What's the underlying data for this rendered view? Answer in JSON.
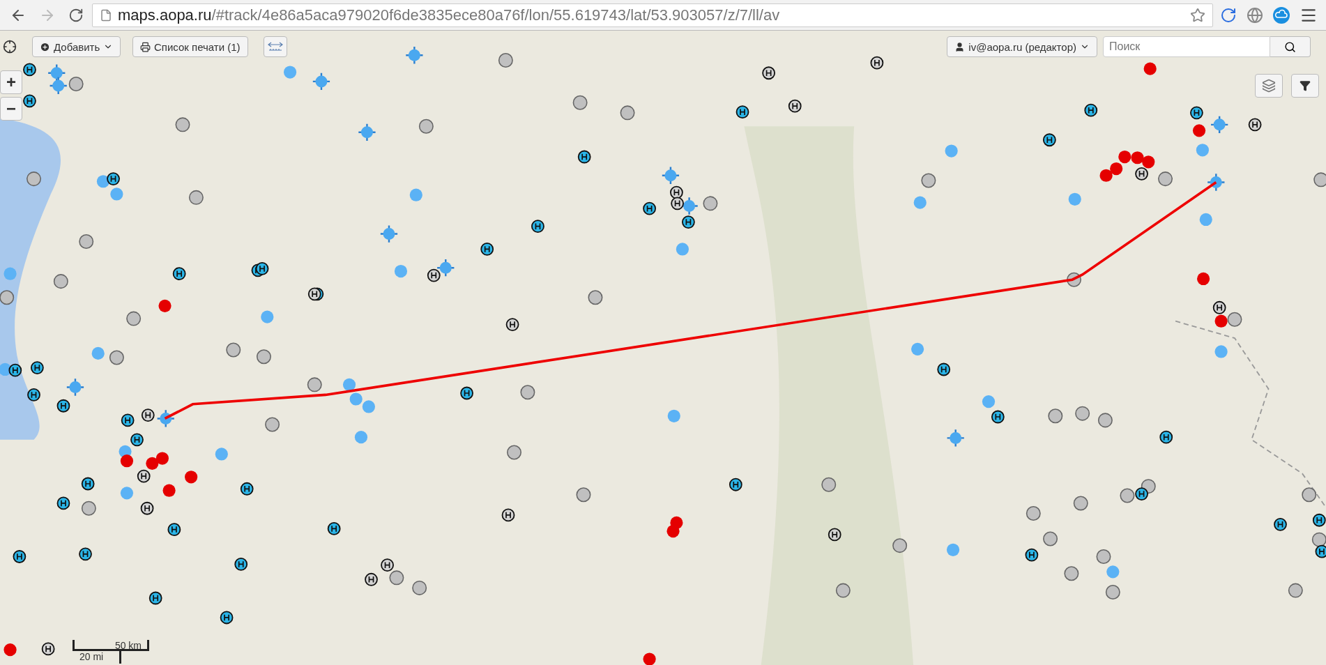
{
  "browser": {
    "url_host": "maps.aopa.ru",
    "url_path": "/#track/4e86a5aca979020f6de3835ece80a76f/lon/55.619743/lat/53.903057/z/7/ll/av"
  },
  "toolbar": {
    "add_button": "Добавить",
    "print_list_button": "Список печати (1)"
  },
  "user_menu": {
    "label": "iv@aopa.ru (редактор)"
  },
  "search": {
    "placeholder": "Поиск"
  },
  "zoom": {
    "in": "+",
    "out": "−"
  },
  "scale": {
    "metric": "50 km",
    "imperial": "20 mi"
  }
}
